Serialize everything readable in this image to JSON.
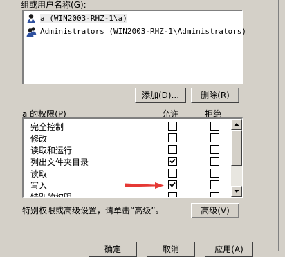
{
  "users_group": {
    "label": "组或用户名称(G):",
    "items": [
      {
        "name": "a (WIN2003-RHZ-1\\a)",
        "selected": true,
        "icon": "user-icon"
      },
      {
        "name": "Administrators (WIN2003-RHZ-1\\Administrators)",
        "selected": false,
        "icon": "group-icon"
      }
    ]
  },
  "buttons": {
    "add": "添加(D)...",
    "remove": "删除(R)",
    "advanced": "高级(V)",
    "ok": "确定",
    "cancel": "取消",
    "apply": "应用(A)"
  },
  "permissions": {
    "title": "a 的权限(P)",
    "allow_header": "允许",
    "deny_header": "拒绝",
    "rows": [
      {
        "name": "完全控制",
        "allow": false,
        "deny": false
      },
      {
        "name": "修改",
        "allow": false,
        "deny": false
      },
      {
        "name": "读取和运行",
        "allow": false,
        "deny": false
      },
      {
        "name": "列出文件夹目录",
        "allow": true,
        "deny": false
      },
      {
        "name": "读取",
        "allow": false,
        "deny": false
      },
      {
        "name": "写入",
        "allow": true,
        "deny": false
      },
      {
        "name": "特别的权限",
        "allow": false,
        "deny": false
      }
    ]
  },
  "advanced_hint": "特别权限或高级设置，请单击“高级”。",
  "colors": {
    "arrow": "#e53935",
    "dialog_bg": "#d4d0c8"
  }
}
